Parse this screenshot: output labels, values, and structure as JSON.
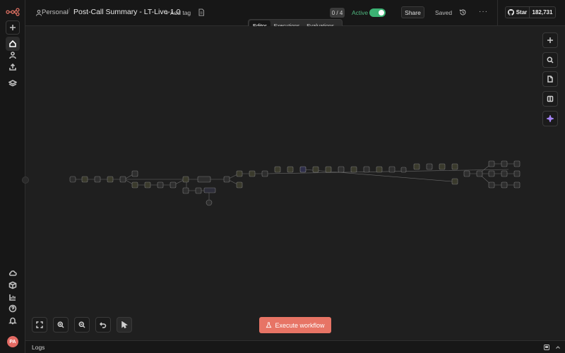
{
  "header": {
    "owner": "Personal",
    "separator": "/",
    "workflow_title": "Post-Call Summary - LT-Live-1.0",
    "add_tag": "+ Add tag",
    "counter": "0 / 4",
    "active_label": "Active",
    "active_on": true,
    "share_label": "Share",
    "saved_label": "Saved",
    "more_label": "···",
    "github_star_label": "Star",
    "github_star_count": "182,731"
  },
  "tabs": [
    {
      "label": "Editor",
      "active": true
    },
    {
      "label": "Executions",
      "active": false
    },
    {
      "label": "Evaluations",
      "active": false
    }
  ],
  "sidebar": {
    "top_icons": [
      "n8n-logo-icon",
      "plus-icon",
      "home-icon",
      "user-icon",
      "share-icon",
      "layers-icon"
    ],
    "bottom_icons": [
      "cloud-icon",
      "templates-icon",
      "insights-icon",
      "help-icon",
      "bell-icon"
    ],
    "avatar_initials": "PA"
  },
  "canvas_right_tools": [
    "plus-icon",
    "search-icon",
    "sticky-note-icon",
    "panel-icon",
    "ai-sparkle-icon"
  ],
  "canvas_bottom_tools": [
    "fit-view-icon",
    "zoom-in-icon",
    "zoom-out-icon",
    "undo-icon",
    "cursor-icon"
  ],
  "execute_button": "Execute workflow",
  "logs_label": "Logs",
  "colors": {
    "accent": "#e77465",
    "active_green": "#3bb273",
    "background": "#1f1f1f",
    "chrome": "#171717"
  }
}
